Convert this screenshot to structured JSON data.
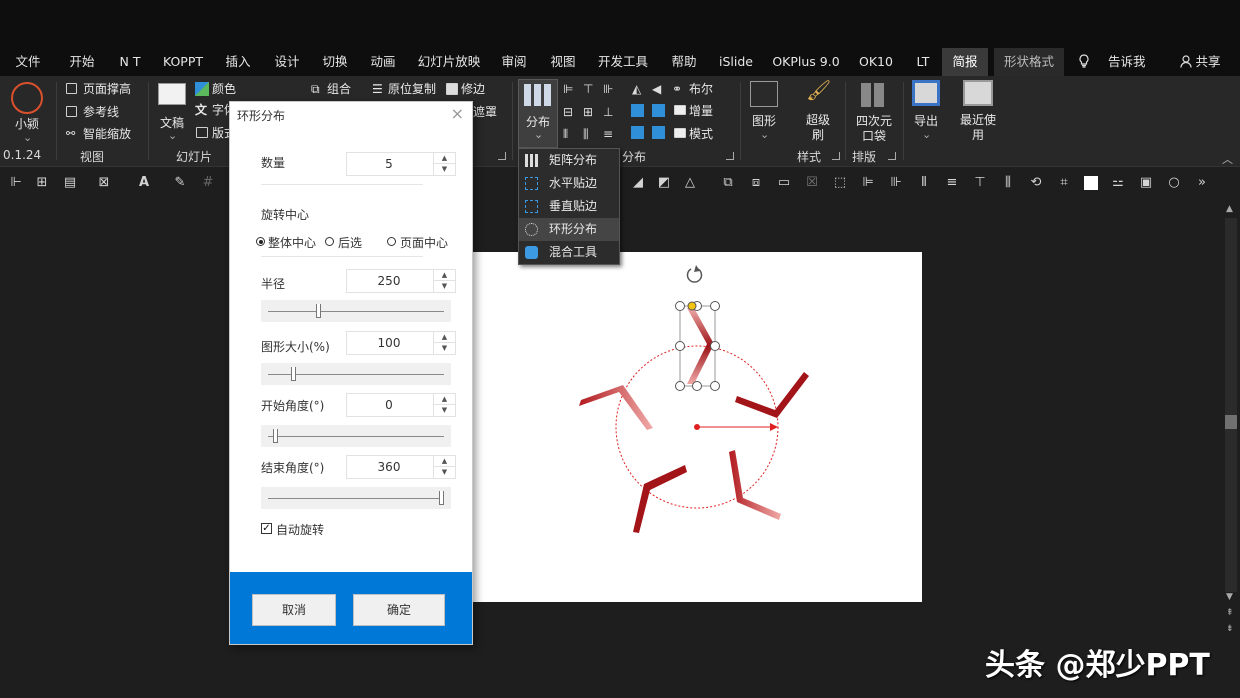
{
  "menu": {
    "tabs": [
      "文件",
      "开始",
      "N T",
      "KOPPT",
      "插入",
      "设计",
      "切换",
      "动画",
      "幻灯片放映",
      "审阅",
      "视图",
      "开发工具",
      "帮助",
      "iSlide",
      "OKPlus 9.0",
      "OK10",
      "LT",
      "简报",
      "形状格式"
    ],
    "tell_me": "告诉我",
    "share": "共享"
  },
  "ribbon": {
    "xiaoying": "小颍",
    "version": "0.1.24",
    "page_height": "页面撑高",
    "guides": "参考线",
    "smart_zoom": "智能缩放",
    "view_group": "视图",
    "color": "颜色",
    "font": "字体",
    "layout": "版式",
    "textbox": "文稿",
    "slides_group": "幻灯片",
    "group": "组合",
    "copy_in_place": "原位复制",
    "trim": "修边",
    "mask": "遮罩",
    "distribute": "分布",
    "distribute_group": "分布",
    "boolean": "布尔",
    "increment": "增量",
    "mode": "模式",
    "shape": "图形",
    "super_brush": "超级刷",
    "style_group": "样式",
    "4d_pocket": "四次元口袋",
    "layout_group": "排版",
    "export": "导出",
    "recent": "最近使用"
  },
  "dropdown": {
    "items": [
      "矩阵分布",
      "水平贴边",
      "垂直贴边",
      "环形分布",
      "混合工具"
    ]
  },
  "dialog": {
    "title": "环形分布",
    "count_label": "数量",
    "count_value": "5",
    "rotation_center": "旋转中心",
    "radio_whole": "整体中心",
    "radio_last": "后选",
    "radio_page": "页面中心",
    "radius_label": "半径",
    "radius_value": "250",
    "size_label": "图形大小(%)",
    "size_value": "100",
    "start_label": "开始角度(°)",
    "start_value": "0",
    "end_label": "结束角度(°)",
    "end_value": "360",
    "auto_rotate": "自动旋转",
    "cancel": "取消",
    "ok": "确定"
  },
  "watermark": "头条 @郑少PPT",
  "colors": {
    "accent_blue": "#0078d7",
    "shape_red": "#a31419",
    "dark_bg": "#1e1e1e"
  }
}
